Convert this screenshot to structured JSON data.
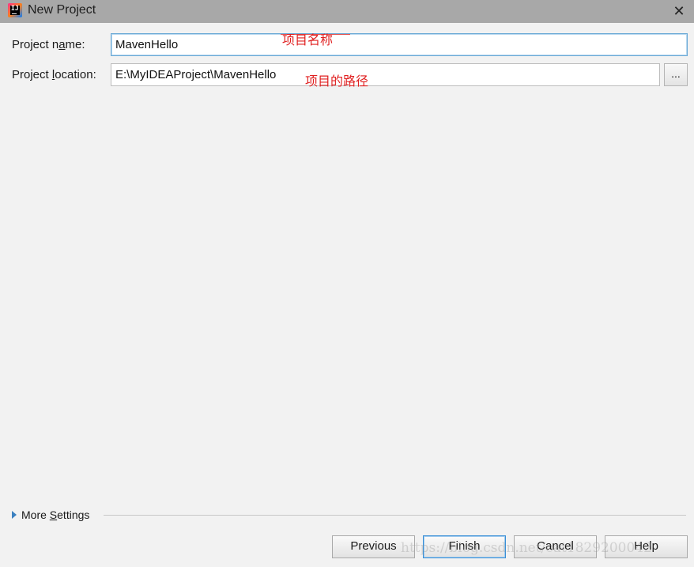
{
  "window": {
    "title": "New Project",
    "app_icon": "intellij-idea-icon",
    "app_icon_text": "IJ",
    "close_glyph": "✕"
  },
  "form": {
    "name_label_pre": "Project n",
    "name_label_mnemonic": "a",
    "name_label_post": "me:",
    "name_value": "MavenHello",
    "location_label_pre": "Project ",
    "location_label_mnemonic": "l",
    "location_label_post": "ocation:",
    "location_value": "E:\\MyIDEAProject\\MavenHello",
    "browse_label": "..."
  },
  "annotations": {
    "name_note": "项目名称",
    "location_note": "项目的路径",
    "color": "#e02020"
  },
  "more_settings": {
    "label_pre": "More ",
    "label_mnemonic": "S",
    "label_post": "ettings"
  },
  "buttons": {
    "previous": "Previous",
    "finish": "Finish",
    "cancel": "Cancel",
    "help": "Help"
  },
  "watermark": "https://blog.csdn.net/cat1829200042"
}
